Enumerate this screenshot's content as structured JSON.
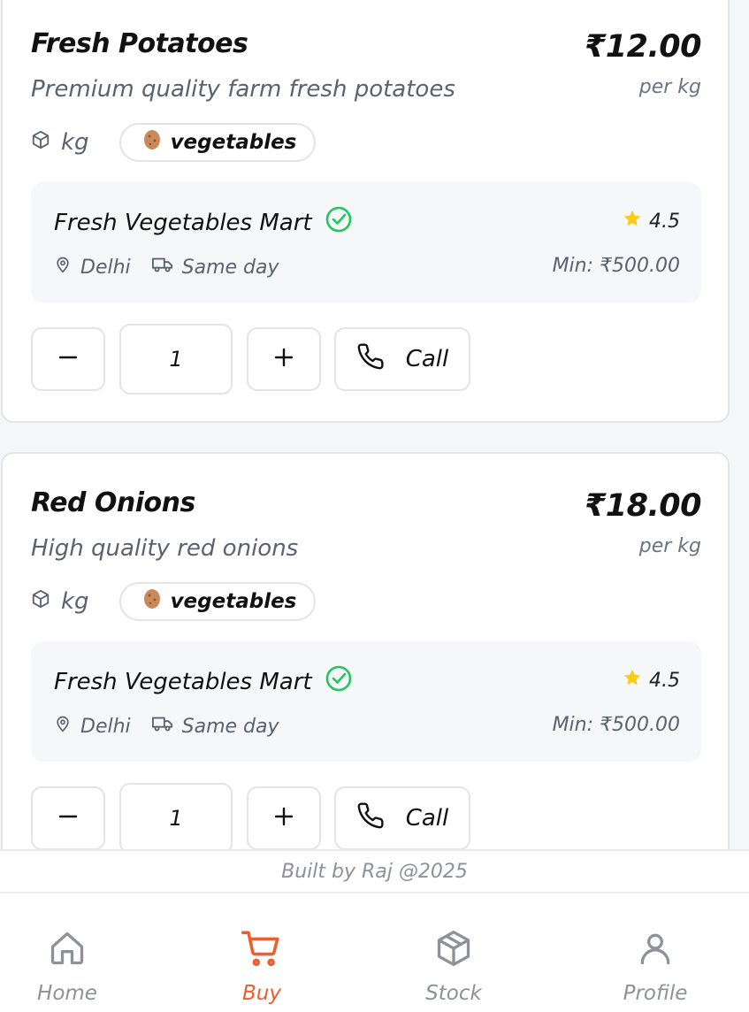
{
  "products": [
    {
      "title": "Fresh Potatoes",
      "description": "Premium quality farm fresh potatoes",
      "price": "₹12.00",
      "per_unit": "per kg",
      "unit": "kg",
      "category": "vegetables",
      "seller": {
        "name": "Fresh Vegetables Mart",
        "rating": "4.5",
        "location": "Delhi",
        "delivery": "Same day",
        "min_order": "Min: ₹500.00"
      },
      "quantity": "1",
      "call_label": "Call"
    },
    {
      "title": "Red Onions",
      "description": "High quality red onions",
      "price": "₹18.00",
      "per_unit": "per kg",
      "unit": "kg",
      "category": "vegetables",
      "seller": {
        "name": "Fresh Vegetables Mart",
        "rating": "4.5",
        "location": "Delhi",
        "delivery": "Same day",
        "min_order": "Min: ₹500.00"
      },
      "quantity": "1",
      "call_label": "Call"
    }
  ],
  "footer": {
    "credit": "Built by Raj @2025"
  },
  "nav": {
    "items": [
      {
        "label": "Home",
        "icon": "home-icon"
      },
      {
        "label": "Buy",
        "icon": "cart-icon"
      },
      {
        "label": "Stock",
        "icon": "box-icon"
      },
      {
        "label": "Profile",
        "icon": "user-icon"
      }
    ],
    "active": "Buy"
  },
  "colors": {
    "accent": "#f05d2c",
    "verified": "#22c55e",
    "star": "#facc15",
    "muted": "#8c919a"
  }
}
